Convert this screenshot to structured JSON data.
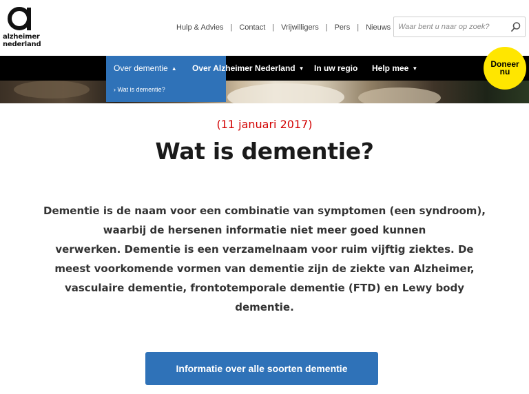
{
  "logo": {
    "line1": "alzheimer",
    "line2": "nederland"
  },
  "top_nav": {
    "items": [
      "Hulp & Advies",
      "Contact",
      "Vrijwilligers",
      "Pers",
      "Nieuws"
    ],
    "separator": "|"
  },
  "search": {
    "placeholder": "Waar bent u naar op zoek?"
  },
  "main_nav": {
    "items": [
      {
        "label": "Over dementie",
        "caret": "▲",
        "active": true
      },
      {
        "label": "Over Alzheimer Nederland",
        "caret": "▼"
      },
      {
        "label": "In uw regio",
        "caret": ""
      },
      {
        "label": "Help mee",
        "caret": "▼"
      }
    ]
  },
  "submenu": {
    "item": "› Wat is dementie?"
  },
  "donate": {
    "line1": "Doneer",
    "line2": "nu"
  },
  "content": {
    "date": "(11 januari 2017)",
    "title": "Wat is dementie?",
    "paragraph_lines": [
      "Dementie is de naam voor een combinatie van symptomen (een syndroom),",
      "waarbij de hersenen informatie niet meer goed kunnen",
      "verwerken. Dementie is een verzamelnaam voor ruim vijftig ziektes. De",
      "meest voorkomende vormen van dementie zijn de ziekte van Alzheimer,",
      "vasculaire dementie, frontotemporale dementie (FTD) en Lewy body",
      "dementie."
    ],
    "cta_label": "Informatie over alle soorten dementie"
  },
  "colors": {
    "nav_bg": "#000000",
    "active_blue": "#2f72b8",
    "donate_yellow": "#ffe600",
    "date_red": "#d20000"
  }
}
